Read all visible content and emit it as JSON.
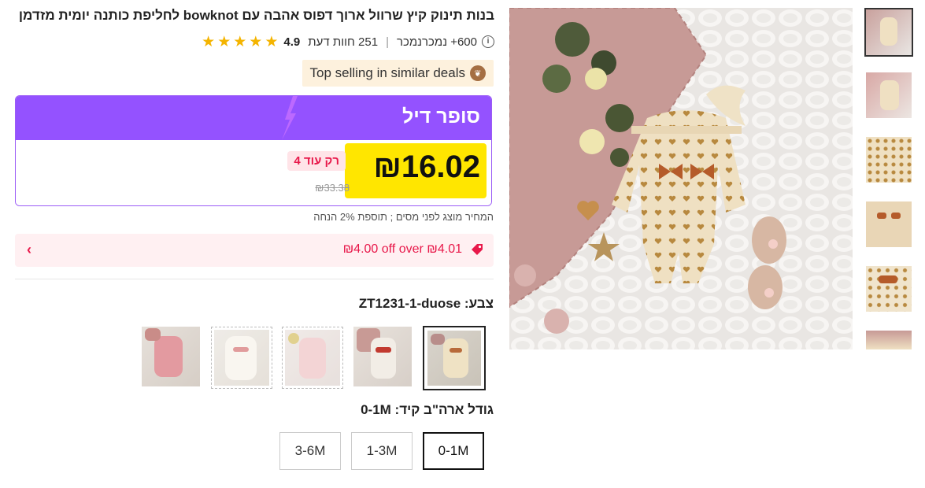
{
  "product": {
    "title": "בנות תינוק קיץ שרוול ארוך דפוס אהבה עם bowknot לחליפת כותנה יומית מזדמן",
    "rating": "4.9",
    "stars_count": 5,
    "reviews": "251 חוות דעת",
    "sold": "600+ נמכרנמכר",
    "info_icon": "info-icon"
  },
  "badge": {
    "label": "Top selling in similar deals",
    "icon": "leaf-icon"
  },
  "deal": {
    "title": "סופר דיל",
    "price": "₪16.02",
    "only_left": "רק עוד 4",
    "original_price": "₪33.38",
    "header_color": "#9452ff",
    "highlight_color": "#ffe600"
  },
  "tax_note": "המחיר מוצג לפני מסים ; תוספת 2% הנחה",
  "coupon": {
    "text": "₪4.00 off over ₪4.01",
    "icon": "tag-icon",
    "arrow_icon": "chevron-left-icon"
  },
  "color": {
    "label": "צבע: ZT1231-1-duose",
    "swatches": [
      "beige-hearts",
      "pink-knit-red",
      "pink-floral",
      "white-lace",
      "pink-solid"
    ],
    "selected_index": 0
  },
  "size": {
    "label": "גודל ארה\"ב קיד: 0-1M",
    "options": [
      "0-1M",
      "1-3M",
      "3-6M"
    ],
    "selected": "0-1M"
  },
  "gallery": {
    "thumbnail_count": 6,
    "selected_index": 0
  }
}
